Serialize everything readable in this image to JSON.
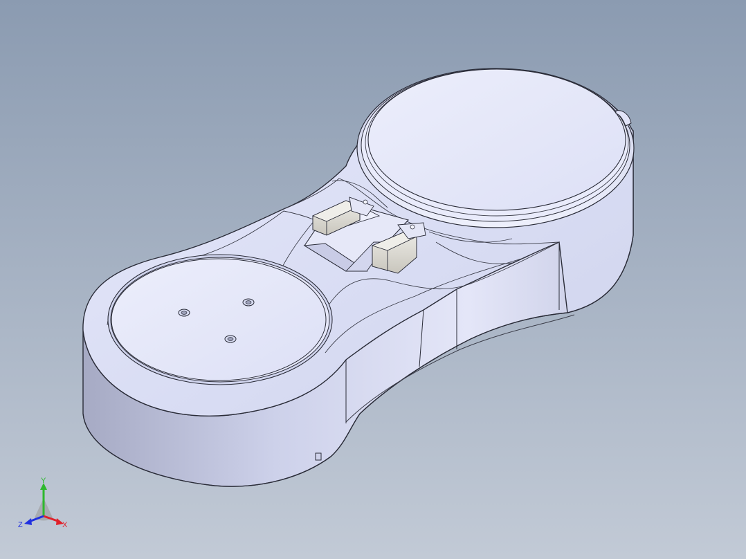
{
  "viewport": {
    "background_top": "#8b9bb1",
    "background_bottom": "#c2cad6"
  },
  "model": {
    "body_color": "#dde1f6",
    "outline_color": "#2a2c38",
    "switch_color": "#d8d6d0"
  },
  "triad": {
    "x_label": "X",
    "y_label": "Y",
    "z_label": "Z",
    "x_color": "#e0202a",
    "y_color": "#2eb82e",
    "z_color": "#2030e0"
  }
}
